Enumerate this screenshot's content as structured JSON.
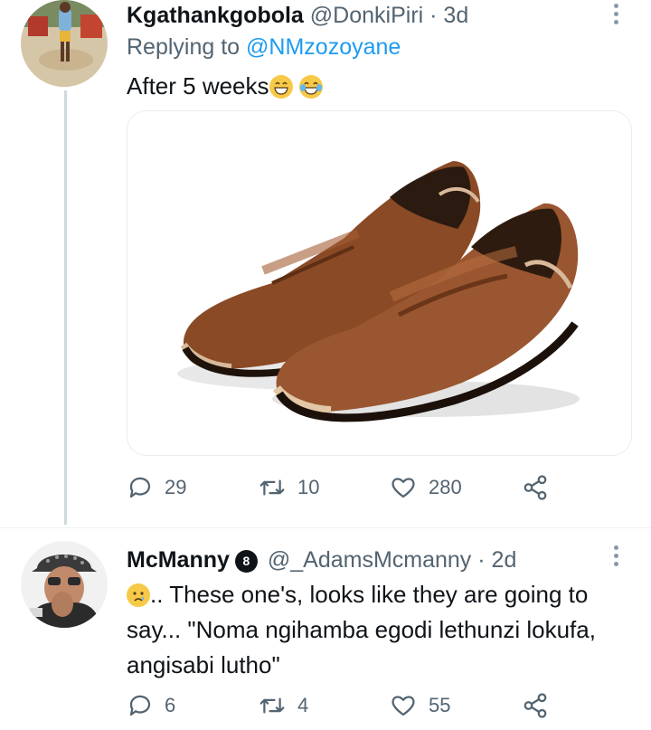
{
  "tweets": [
    {
      "display_name": "Kgathankgobola",
      "handle": "@DonkiPiri",
      "time": "· 3d",
      "replying_prefix": "Replying to",
      "replying_handle": "@NMzozoyane",
      "text": "After 5 weeks",
      "emojis": [
        "grinning-face-emoji",
        "tears-of-joy-emoji"
      ],
      "actions": {
        "replies": "29",
        "retweets": "10",
        "likes": "280"
      }
    },
    {
      "display_name": "McManny",
      "badge": "8",
      "handle": "@_AdamsMcmanny",
      "time": "· 2d",
      "text_line1": ".. These one's, looks like they are going to",
      "text_line2": "say... \"Noma ngihamba egodi lethunzi lokufa,",
      "text_line3": "angisabi lutho\"",
      "emojis": [
        "crying-face-emoji"
      ],
      "actions": {
        "replies": "6",
        "retweets": "4",
        "likes": "55"
      }
    }
  ],
  "icons": [
    "reply-icon",
    "retweet-icon",
    "like-icon",
    "share-icon",
    "more-icon"
  ],
  "colors": {
    "accent": "#1d9bf0",
    "muted": "#536471",
    "text": "#0f1419"
  }
}
